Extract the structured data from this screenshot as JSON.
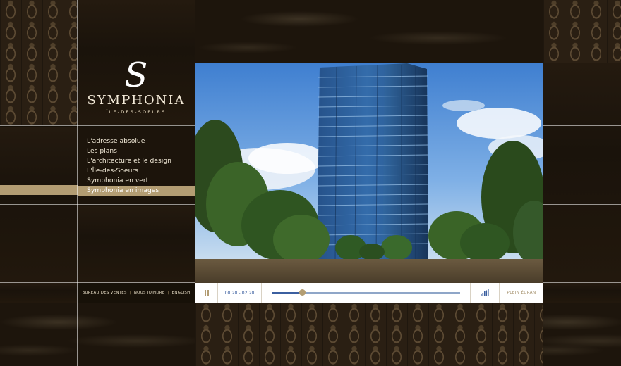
{
  "brand": {
    "mark": "S",
    "name": "SYMPHONIA",
    "subtitle": "ÎLE-DES-SOEURS"
  },
  "nav": {
    "items": [
      {
        "label": "L'adresse absolue",
        "active": false
      },
      {
        "label": "Les plans",
        "active": false
      },
      {
        "label": "L'architecture et le design",
        "active": false
      },
      {
        "label": "L'Île-des-Soeurs",
        "active": false
      },
      {
        "label": "Symphonia en vert",
        "active": false
      },
      {
        "label": "Symphonia en images",
        "active": true
      }
    ]
  },
  "footer": {
    "links": [
      "BUREAU DES VENTES",
      "NOUS JOINDRE",
      "ENGLISH"
    ],
    "separator": "|"
  },
  "player": {
    "time": "00:20 - 02:20",
    "progress_fraction": 0.16,
    "fullscreen_label": "PLEIN ÉCRAN",
    "pause_icon": "pause-icon",
    "volume_icon": "volume-bars-icon"
  },
  "colors": {
    "accent": "#b39d73",
    "background": "#171108",
    "progress_blue": "#3b5fa0"
  }
}
